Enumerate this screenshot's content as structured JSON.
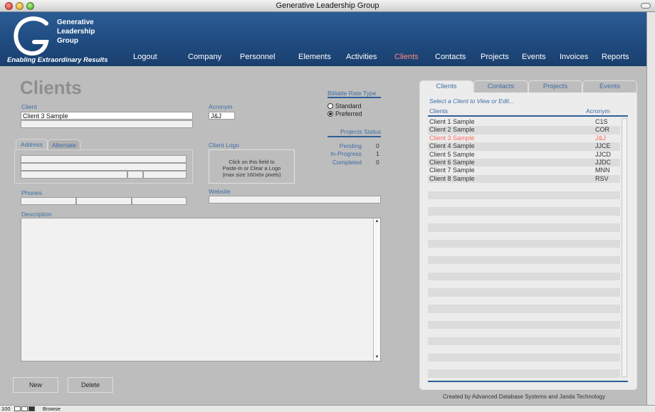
{
  "window": {
    "title": "Generative Leadership Group"
  },
  "brand": {
    "logo_line1": "Generative",
    "logo_line2": "Leadership",
    "logo_line3": "Group",
    "tagline": "Enabling Extraordinary Results"
  },
  "nav": [
    {
      "label": "Logout"
    },
    {
      "label": "Company"
    },
    {
      "label": "Personnel"
    },
    {
      "label": "Elements"
    },
    {
      "label": "Activities"
    },
    {
      "label": "Clients",
      "active": true
    },
    {
      "label": "Contacts"
    },
    {
      "label": "Projects"
    },
    {
      "label": "Events"
    },
    {
      "label": "Invoices"
    },
    {
      "label": "Reports"
    }
  ],
  "form": {
    "page_title": "Clients",
    "client_label": "Client",
    "client_value": "Client 3 Sample",
    "acronym_label": "Acronym",
    "acronym_value": "J&J",
    "address_tab": "Address",
    "alternate_tab": "Alternate",
    "phones_label": "Phones",
    "logo_label": "Client Logo",
    "logo_hint_1": "Click on this field to",
    "logo_hint_2": "Paste-In or Clear a Logo",
    "logo_hint_3": "(max size 160x6x pixels)",
    "website_label": "Website",
    "description_label": "Description",
    "billable_label": "Billable Rate Type",
    "billable_options": [
      {
        "label": "Standard",
        "selected": false
      },
      {
        "label": "Preferred",
        "selected": true
      }
    ],
    "projects_status_label": "Projects Status",
    "status": [
      {
        "label": "Pending",
        "value": "0"
      },
      {
        "label": "In-Progress",
        "value": "1"
      },
      {
        "label": "Completed",
        "value": "0"
      }
    ],
    "new_button": "New",
    "delete_button": "Delete"
  },
  "panel": {
    "tabs": [
      "Clients",
      "Contacts",
      "Projects",
      "Events"
    ],
    "active_tab": "Clients",
    "hint": "Select a Client to View or Edit...",
    "col_client": "Clients",
    "col_acronym": "Acronym",
    "rows": [
      {
        "client": "Client 1 Sample",
        "acronym": "C1S"
      },
      {
        "client": "Client 2 Sample",
        "acronym": "COR"
      },
      {
        "client": "Client 3 Sample",
        "acronym": "J&J",
        "selected": true
      },
      {
        "client": "Client 4 Sample",
        "acronym": "JJCE"
      },
      {
        "client": "Client 5 Sample",
        "acronym": "JJCD"
      },
      {
        "client": "Client 6 Sample",
        "acronym": "JJDC"
      },
      {
        "client": "Client 7 Sample",
        "acronym": "MNN"
      },
      {
        "client": "Client 8 Sample",
        "acronym": "RSV"
      }
    ],
    "credit": "Created by Advanced Database Systems and Janda Technology"
  },
  "statusbar": {
    "zoom": "100",
    "mode": "Browse"
  },
  "colors": {
    "accent": "#2d5f97",
    "selected": "#ff6f61",
    "header": "#1f4b80"
  }
}
